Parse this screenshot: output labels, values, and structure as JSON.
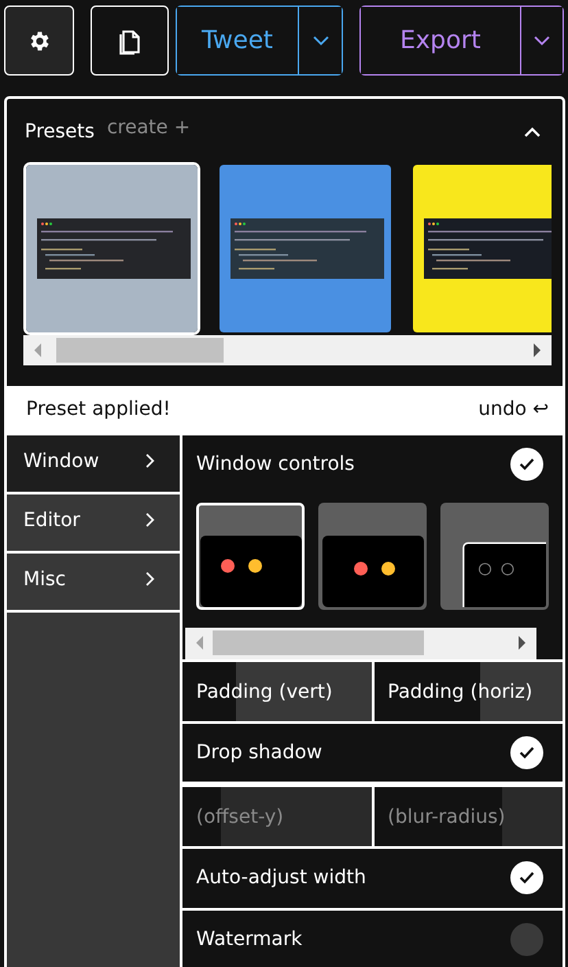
{
  "toolbar": {
    "tweet": "Tweet",
    "export": "Export",
    "settings_active": true
  },
  "presets": {
    "title": "Presets",
    "create": "create +",
    "expanded": true,
    "items": [
      {
        "kind": "picture",
        "selected": true
      },
      {
        "kind": "picture",
        "selected": false
      },
      {
        "kind": "picture",
        "selected": false
      }
    ]
  },
  "toast": {
    "message": "Preset applied!",
    "action": "undo ↩"
  },
  "sidebar": {
    "items": [
      {
        "label": "Window",
        "selected": true
      },
      {
        "label": "Editor",
        "selected": false
      },
      {
        "label": "Misc",
        "selected": false
      }
    ]
  },
  "window_controls": {
    "label": "Window controls",
    "checked": true,
    "options": [
      {
        "kind": "colored",
        "selected": true
      },
      {
        "kind": "colored-offset",
        "selected": false
      },
      {
        "kind": "outline",
        "selected": false
      }
    ]
  },
  "settings": [
    {
      "kind": "pair",
      "fields": [
        {
          "label": "Padding (vert)",
          "level": 0.28,
          "disabled": false
        },
        {
          "label": "Padding (horiz)",
          "level": 0.56,
          "disabled": false
        }
      ]
    },
    {
      "kind": "toggle",
      "label": "Drop shadow",
      "checked": true
    },
    {
      "kind": "pair",
      "fields": [
        {
          "label": "(offset-y)",
          "level": 0.2,
          "disabled": true
        },
        {
          "label": "(blur-radius)",
          "level": 0.68,
          "disabled": true
        }
      ]
    },
    {
      "kind": "toggle",
      "label": "Auto-adjust width",
      "checked": true
    },
    {
      "kind": "toggle",
      "label": "Watermark",
      "checked": false
    }
  ]
}
